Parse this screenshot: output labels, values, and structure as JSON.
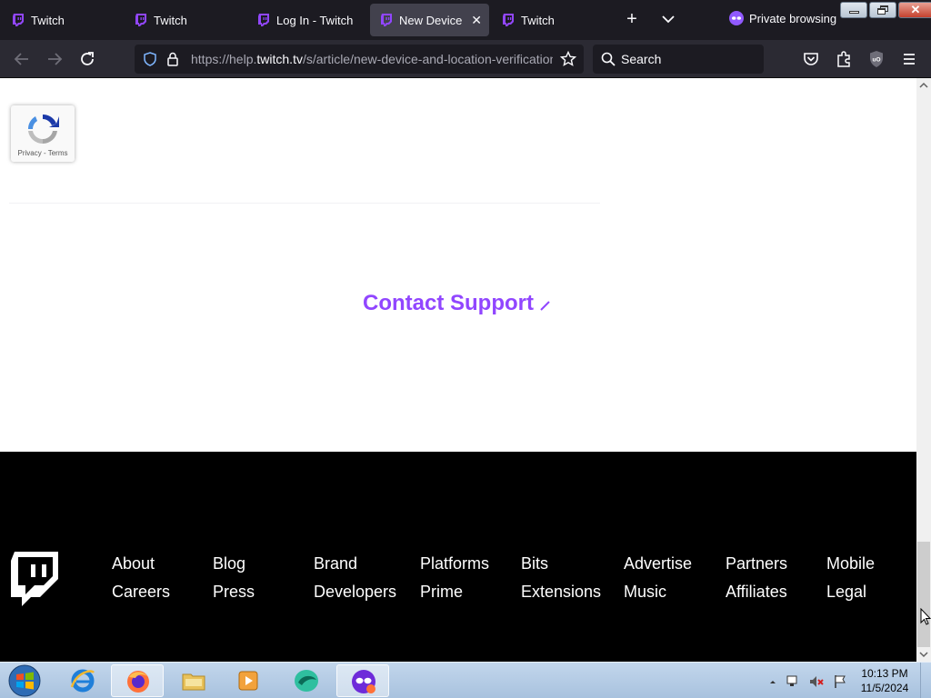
{
  "browser": {
    "tabs": [
      {
        "label": "Twitch"
      },
      {
        "label": "Twitch"
      },
      {
        "label": "Log In - Twitch"
      },
      {
        "label": "New Device and Location Verification"
      },
      {
        "label": "Twitch"
      }
    ],
    "private_label": "Private browsing",
    "url_prefix": "https://help.",
    "url_host": "twitch.tv",
    "url_path": "/s/article/new-device-and-location-verification",
    "search_placeholder": "Search"
  },
  "page": {
    "recaptcha_links": "Privacy - Terms",
    "contact_support": "Contact Support",
    "footer": {
      "links": [
        {
          "label": "About"
        },
        {
          "label": "Blog"
        },
        {
          "label": "Brand"
        },
        {
          "label": "Platforms"
        },
        {
          "label": "Bits"
        },
        {
          "label": "Advertise"
        },
        {
          "label": "Partners"
        },
        {
          "label": "Mobile"
        },
        {
          "label": "Careers"
        },
        {
          "label": "Press"
        },
        {
          "label": "Developers"
        },
        {
          "label": "Prime"
        },
        {
          "label": "Extensions"
        },
        {
          "label": "Music"
        },
        {
          "label": "Affiliates"
        },
        {
          "label": "Legal"
        }
      ]
    }
  },
  "taskbar": {
    "time": "10:13 PM",
    "date": "11/5/2024"
  },
  "colors": {
    "twitch_purple": "#9146ff",
    "footer_bg": "#000000"
  }
}
